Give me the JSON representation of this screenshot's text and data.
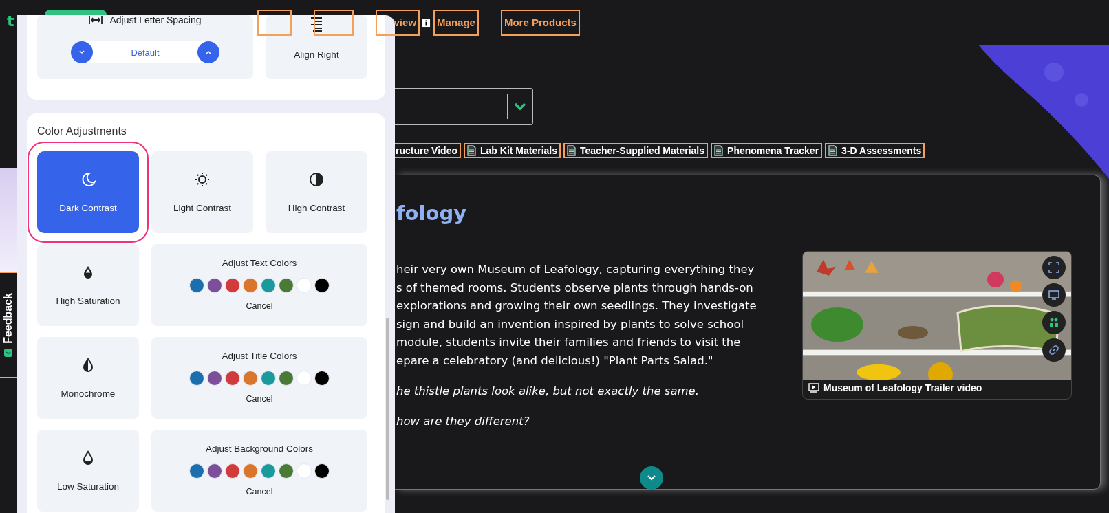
{
  "nav": {
    "logo": "t",
    "items": [
      {
        "label": "view",
        "info": true
      },
      {
        "label": "Manage",
        "info": false
      },
      {
        "label": "More Products",
        "info": false
      }
    ]
  },
  "resources": [
    {
      "label": "ructure Video",
      "icon": false
    },
    {
      "label": "Lab Kit Materials",
      "icon": true
    },
    {
      "label": "Teacher-Supplied Materials",
      "icon": true
    },
    {
      "label": "Phenomena Tracker",
      "icon": true
    },
    {
      "label": "3-D Assessments",
      "icon": true
    }
  ],
  "lesson": {
    "title": "fology",
    "paragraph": [
      "heir very own Museum of Leafology, capturing everything they",
      "s of themed rooms. Students observe plants through hands-on",
      "explorations and growing their own seedlings. They investigate",
      "sign and build an invention inspired by plants to solve school",
      "module, students invite their families and friends to visit the",
      "epare a celebratory (and delicious!) \"Plant Parts Salad.\""
    ],
    "questions": [
      "he thistle plants look alike, but not exactly the same.",
      "how are they different?"
    ],
    "video": {
      "kind": "picture",
      "caption": "Museum of Leafology Trailer video"
    }
  },
  "feedback": {
    "label": "Feedback"
  },
  "panel": {
    "letter_spacing": {
      "label": "Adjust Letter Spacing",
      "value": "Default"
    },
    "align": {
      "label": "Align Right"
    },
    "color_section": {
      "title": "Color Adjustments",
      "modes": [
        {
          "label": "Dark Contrast",
          "selected": true
        },
        {
          "label": "Light Contrast",
          "selected": false
        },
        {
          "label": "High Contrast",
          "selected": false
        }
      ],
      "rows": [
        {
          "mode": {
            "label": "High Saturation",
            "selected": false
          },
          "palette": {
            "title": "Adjust Text Colors",
            "cancel": "Cancel",
            "swatches": [
              {
                "color": "#1b6fae"
              },
              {
                "color": "#7d4f9b"
              },
              {
                "color": "#d13b3b"
              },
              {
                "color": "#d9762b"
              },
              {
                "color": "#1a9a9c"
              },
              {
                "color": "#4a7a35"
              },
              {
                "color": "#ffffff"
              },
              {
                "color": "#000000"
              }
            ]
          }
        },
        {
          "mode": {
            "label": "Monochrome",
            "selected": false
          },
          "palette": {
            "title": "Adjust Title Colors",
            "cancel": "Cancel",
            "swatches": [
              {
                "color": "#1b6fae"
              },
              {
                "color": "#7d4f9b"
              },
              {
                "color": "#d13b3b"
              },
              {
                "color": "#d9762b"
              },
              {
                "color": "#1a9a9c"
              },
              {
                "color": "#4a7a35"
              },
              {
                "color": "#ffffff"
              },
              {
                "color": "#000000"
              }
            ]
          }
        },
        {
          "mode": {
            "label": "Low Saturation",
            "selected": false
          },
          "palette": {
            "title": "Adjust Background Colors",
            "cancel": "Cancel",
            "swatches": [
              {
                "color": "#1b6fae"
              },
              {
                "color": "#7d4f9b"
              },
              {
                "color": "#d13b3b"
              },
              {
                "color": "#d9762b"
              },
              {
                "color": "#1a9a9c"
              },
              {
                "color": "#4a7a35"
              },
              {
                "color": "#ffffff"
              },
              {
                "color": "#000000"
              }
            ]
          }
        }
      ]
    }
  }
}
